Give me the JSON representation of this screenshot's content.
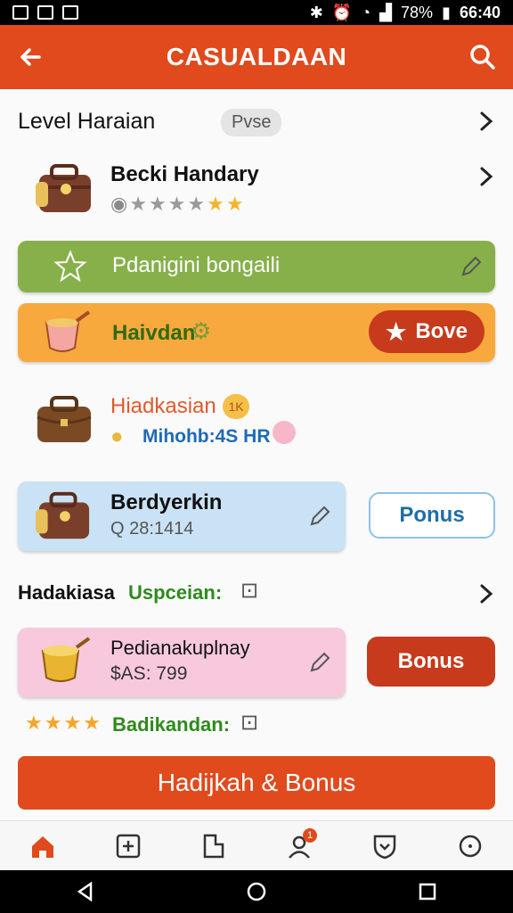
{
  "status": {
    "time": "66:40",
    "battery": "78%"
  },
  "appbar": {
    "title": "CASUALDAAN"
  },
  "section1": {
    "title": "Level Haraian",
    "pill": "Pvse"
  },
  "item1": {
    "name": "Becki Handary",
    "rating_stars": 7,
    "rating_filled": 2
  },
  "card_green": {
    "text": "Pdanigini bongaili"
  },
  "card_orange": {
    "text": "Haivdan",
    "button": "Bove"
  },
  "item2": {
    "name": "Hiadkasian",
    "badge": "1K",
    "subtext": "Mihohb:4S HR"
  },
  "card_blue": {
    "name": "Berdyerkin",
    "subtext": "Q 28:1414",
    "button": "Ponus"
  },
  "section2": {
    "title": "Hadakiasa",
    "subtitle": "Uspceian:"
  },
  "card_pink": {
    "name": "Pedianakuplnay",
    "subtext": "$AS: 799",
    "button": "Bonus"
  },
  "rating_row": {
    "text": "Badikandan:",
    "stars": 4
  },
  "primary_button": {
    "label": "Hadijkah & Bonus"
  },
  "bottom_nav": {
    "badge": "1"
  },
  "colors": {
    "accent": "#e04a1d",
    "green": "#87b04b",
    "orange": "#f8a93d",
    "blue": "#c9e2f5",
    "pink": "#f8c9dd",
    "button_red": "#c73a1c"
  }
}
